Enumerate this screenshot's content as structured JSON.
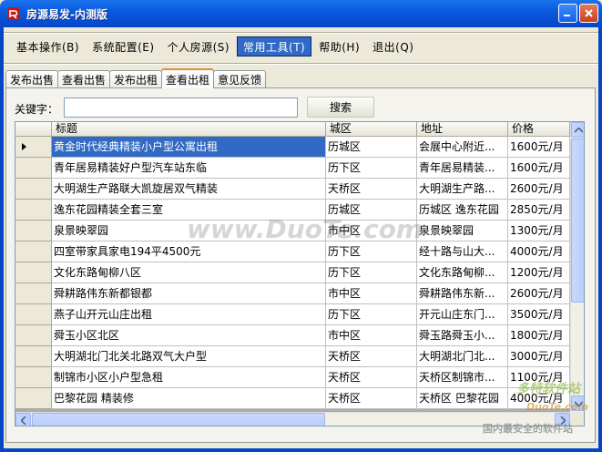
{
  "window": {
    "title": "房源易发-内测版"
  },
  "menu": [
    {
      "label": "基本操作(B)",
      "active": false
    },
    {
      "label": "系统配置(E)",
      "active": false
    },
    {
      "label": "个人房源(S)",
      "active": false
    },
    {
      "label": "常用工具(T)",
      "active": true
    },
    {
      "label": "帮助(H)",
      "active": false
    },
    {
      "label": "退出(Q)",
      "active": false
    }
  ],
  "tabs": [
    {
      "label": "发布出售",
      "active": false
    },
    {
      "label": "查看出售",
      "active": false
    },
    {
      "label": "发布出租",
      "active": false
    },
    {
      "label": "查看出租",
      "active": true
    },
    {
      "label": "意见反馈",
      "active": false
    }
  ],
  "search": {
    "label": "关键字：",
    "value": "",
    "button": "搜索"
  },
  "table": {
    "columns": [
      "标题",
      "城区",
      "地址",
      "价格"
    ],
    "selected_row": 0,
    "rows": [
      [
        "黄金时代经典精装小户型公寓出租",
        "历城区",
        "会展中心附近...",
        "1600元/月"
      ],
      [
        "青年居易精装好户型汽车站东临",
        "历下区",
        "青年居易精装...",
        "1600元/月"
      ],
      [
        "大明湖生产路联大凯旋居双气精装",
        "天桥区",
        "大明湖生产路...",
        "2600元/月"
      ],
      [
        "逸东花园精装全套三室",
        "历城区",
        "历城区 逸东花园",
        "2850元/月"
      ],
      [
        "泉景映翠园",
        "市中区",
        "泉景映翠园",
        "1300元/月"
      ],
      [
        "四室带家具家电194平4500元",
        "历下区",
        "经十路与山大...",
        "4000元/月"
      ],
      [
        "文化东路甸柳八区",
        "历下区",
        "文化东路甸柳...",
        "1200元/月"
      ],
      [
        "舜耕路伟东新都银都",
        "市中区",
        "舜耕路伟东新...",
        "2600元/月"
      ],
      [
        "燕子山开元山庄出租",
        "历下区",
        "开元山庄东门...",
        "3500元/月"
      ],
      [
        "舜玉小区北区",
        "市中区",
        "舜玉路舜玉小...",
        "1800元/月"
      ],
      [
        "大明湖北门北关北路双气大户型",
        "天桥区",
        "大明湖北门北...",
        "3000元/月"
      ],
      [
        "制锦市小区小户型急租",
        "天桥区",
        "天桥区制锦市...",
        "1100元/月"
      ],
      [
        "巴黎花园  精装修",
        "天桥区",
        "天桥区 巴黎花园",
        "4000元/月"
      ]
    ]
  },
  "watermarks": {
    "center": "www.DuoTe.com",
    "corner_brand": "多特软件站",
    "corner_url": "DuoTe.com",
    "corner_slogan": "国内最安全的软件站"
  }
}
